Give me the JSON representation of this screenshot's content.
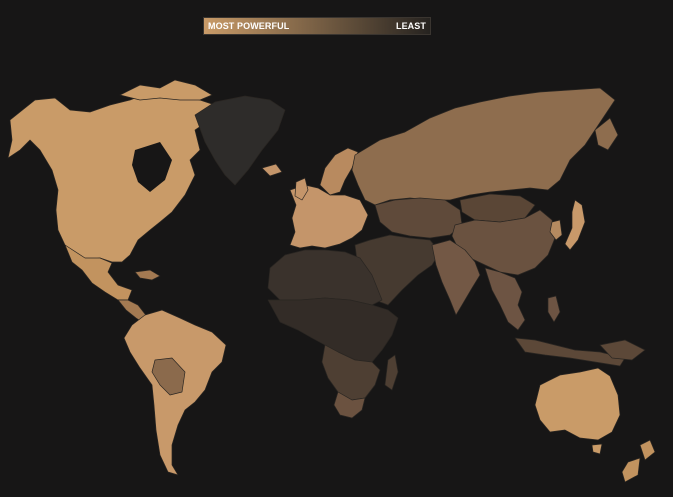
{
  "legend": {
    "left_label": "MOST POWERFUL",
    "right_label": "LEAST",
    "gradient_start": "#c99b68",
    "gradient_end": "#262320"
  },
  "colors": {
    "background": "#171616",
    "border": "#2a2622"
  },
  "regions": [
    {
      "id": "north-america",
      "power_level": 1.0,
      "color": "#c99b68"
    },
    {
      "id": "mexico",
      "power_level": 0.9,
      "color": "#c2935f"
    },
    {
      "id": "central-america",
      "power_level": 0.75,
      "color": "#a47a52"
    },
    {
      "id": "greenland",
      "power_level": 0.0,
      "color": "#2b2a29"
    },
    {
      "id": "south-america",
      "power_level": 0.95,
      "color": "#c8996a"
    },
    {
      "id": "bolivia-paraguay",
      "power_level": 0.55,
      "color": "#8b6a4c"
    },
    {
      "id": "europe-west",
      "power_level": 0.9,
      "color": "#c4956a"
    },
    {
      "id": "scandinavia",
      "power_level": 0.85,
      "color": "#b88a5f"
    },
    {
      "id": "russia",
      "power_level": 0.6,
      "color": "#8e6d4e"
    },
    {
      "id": "central-asia",
      "power_level": 0.4,
      "color": "#5f4a3a"
    },
    {
      "id": "china",
      "power_level": 0.45,
      "color": "#6a5240"
    },
    {
      "id": "middle-east",
      "power_level": 0.25,
      "color": "#463a30"
    },
    {
      "id": "india",
      "power_level": 0.5,
      "color": "#735845"
    },
    {
      "id": "southeast-asia",
      "power_level": 0.45,
      "color": "#6d5443"
    },
    {
      "id": "japan",
      "power_level": 0.9,
      "color": "#c8996a"
    },
    {
      "id": "korea",
      "power_level": 0.8,
      "color": "#b58a60"
    },
    {
      "id": "africa-north",
      "power_level": 0.15,
      "color": "#3a322c"
    },
    {
      "id": "africa-central",
      "power_level": 0.1,
      "color": "#332c27"
    },
    {
      "id": "africa-south",
      "power_level": 0.3,
      "color": "#4e3f33"
    },
    {
      "id": "south-africa",
      "power_level": 0.45,
      "color": "#6b5240"
    },
    {
      "id": "indonesia",
      "power_level": 0.4,
      "color": "#5c4838"
    },
    {
      "id": "australia",
      "power_level": 1.0,
      "color": "#c99b68"
    },
    {
      "id": "new-zealand",
      "power_level": 0.9,
      "color": "#c2935f"
    }
  ]
}
